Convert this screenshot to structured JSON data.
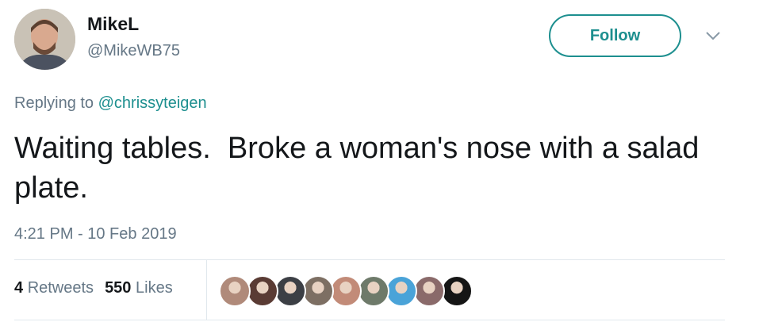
{
  "user": {
    "display_name": "MikeL",
    "handle": "@MikeWB75"
  },
  "actions": {
    "follow_label": "Follow"
  },
  "tweet": {
    "replying_prefix": "Replying to ",
    "replying_to": "@chrissyteigen",
    "text": "Waiting tables.  Broke a woman's nose with a salad plate.",
    "timestamp": "4:21 PM - 10 Feb 2019"
  },
  "stats": {
    "retweets_count": "4",
    "retweets_label": "Retweets",
    "likes_count": "550",
    "likes_label": "Likes"
  },
  "colors": {
    "accent": "#1d8f8f",
    "secondary_text": "#657786",
    "divider": "#e1e8ed"
  },
  "likers": [
    {
      "name": "liker-avatar-1",
      "color": "#b08a7a"
    },
    {
      "name": "liker-avatar-2",
      "color": "#5a3b34"
    },
    {
      "name": "liker-avatar-3",
      "color": "#3c3f45"
    },
    {
      "name": "liker-avatar-4",
      "color": "#7d6f63"
    },
    {
      "name": "liker-avatar-5",
      "color": "#c28b78"
    },
    {
      "name": "liker-avatar-6",
      "color": "#6e7a6a"
    },
    {
      "name": "liker-avatar-7",
      "color": "#4aa3d8"
    },
    {
      "name": "liker-avatar-8",
      "color": "#8a6a6a"
    },
    {
      "name": "liker-avatar-9",
      "color": "#151515"
    }
  ]
}
